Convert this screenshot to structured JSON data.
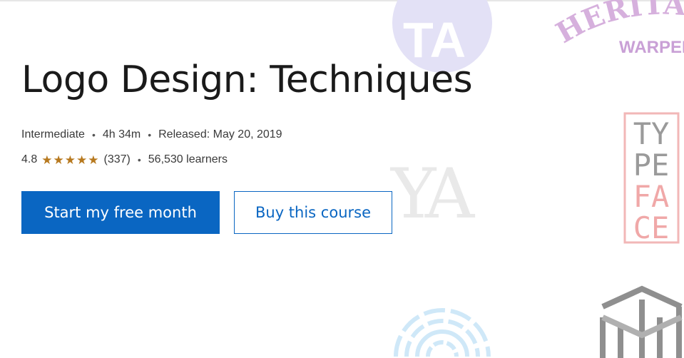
{
  "course": {
    "title": "Logo Design: Techniques",
    "level": "Intermediate",
    "duration": "4h 34m",
    "released": "Released: May 20, 2019",
    "rating_value": "4.8",
    "star_count": 5,
    "review_count": "(337)",
    "learners": "56,530 learners"
  },
  "actions": {
    "primary_label": "Start my free month",
    "secondary_label": "Buy this course"
  },
  "decorations": {
    "heritage_word": "HERITA",
    "warped_word": "WARPED",
    "ta_word": "TA",
    "ya_word": "YA",
    "typeface_rows": [
      "TY",
      "PE",
      "FA",
      "CE"
    ]
  },
  "colors": {
    "accent": "#0a66c2",
    "star": "#b7791f",
    "text": "#1a1a1a"
  },
  "separator": "•"
}
